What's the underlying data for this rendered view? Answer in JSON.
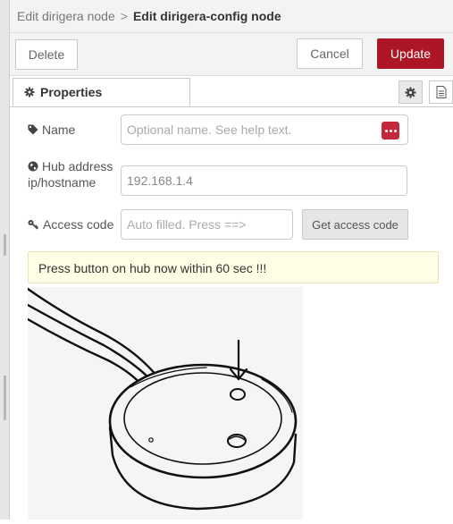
{
  "header": {
    "parent_crumb": "Edit dirigera node",
    "separator": ">",
    "current_crumb": "Edit dirigera-config node"
  },
  "toolbar": {
    "delete_label": "Delete",
    "cancel_label": "Cancel",
    "update_label": "Update",
    "update_color": "#ad1625"
  },
  "tabs": {
    "properties_label": "Properties",
    "icons": [
      "gear-icon",
      "description-icon"
    ]
  },
  "form": {
    "name": {
      "label": "Name",
      "placeholder": "Optional name. See help text.",
      "icon": "tag-icon"
    },
    "hub": {
      "label_line1": "Hub address",
      "label_line2": "ip/hostname",
      "value": "192.168.1.4",
      "icon": "globe-icon"
    },
    "access": {
      "label": "Access code",
      "placeholder": "Auto filled. Press ==>",
      "icon": "key-icon",
      "button_label": "Get access code"
    }
  },
  "notice": {
    "text": "Press button on hub now within 60 sec !!!",
    "background": "#ffffe6"
  },
  "image": {
    "subject": "dirigera-hub-button-illustration"
  }
}
